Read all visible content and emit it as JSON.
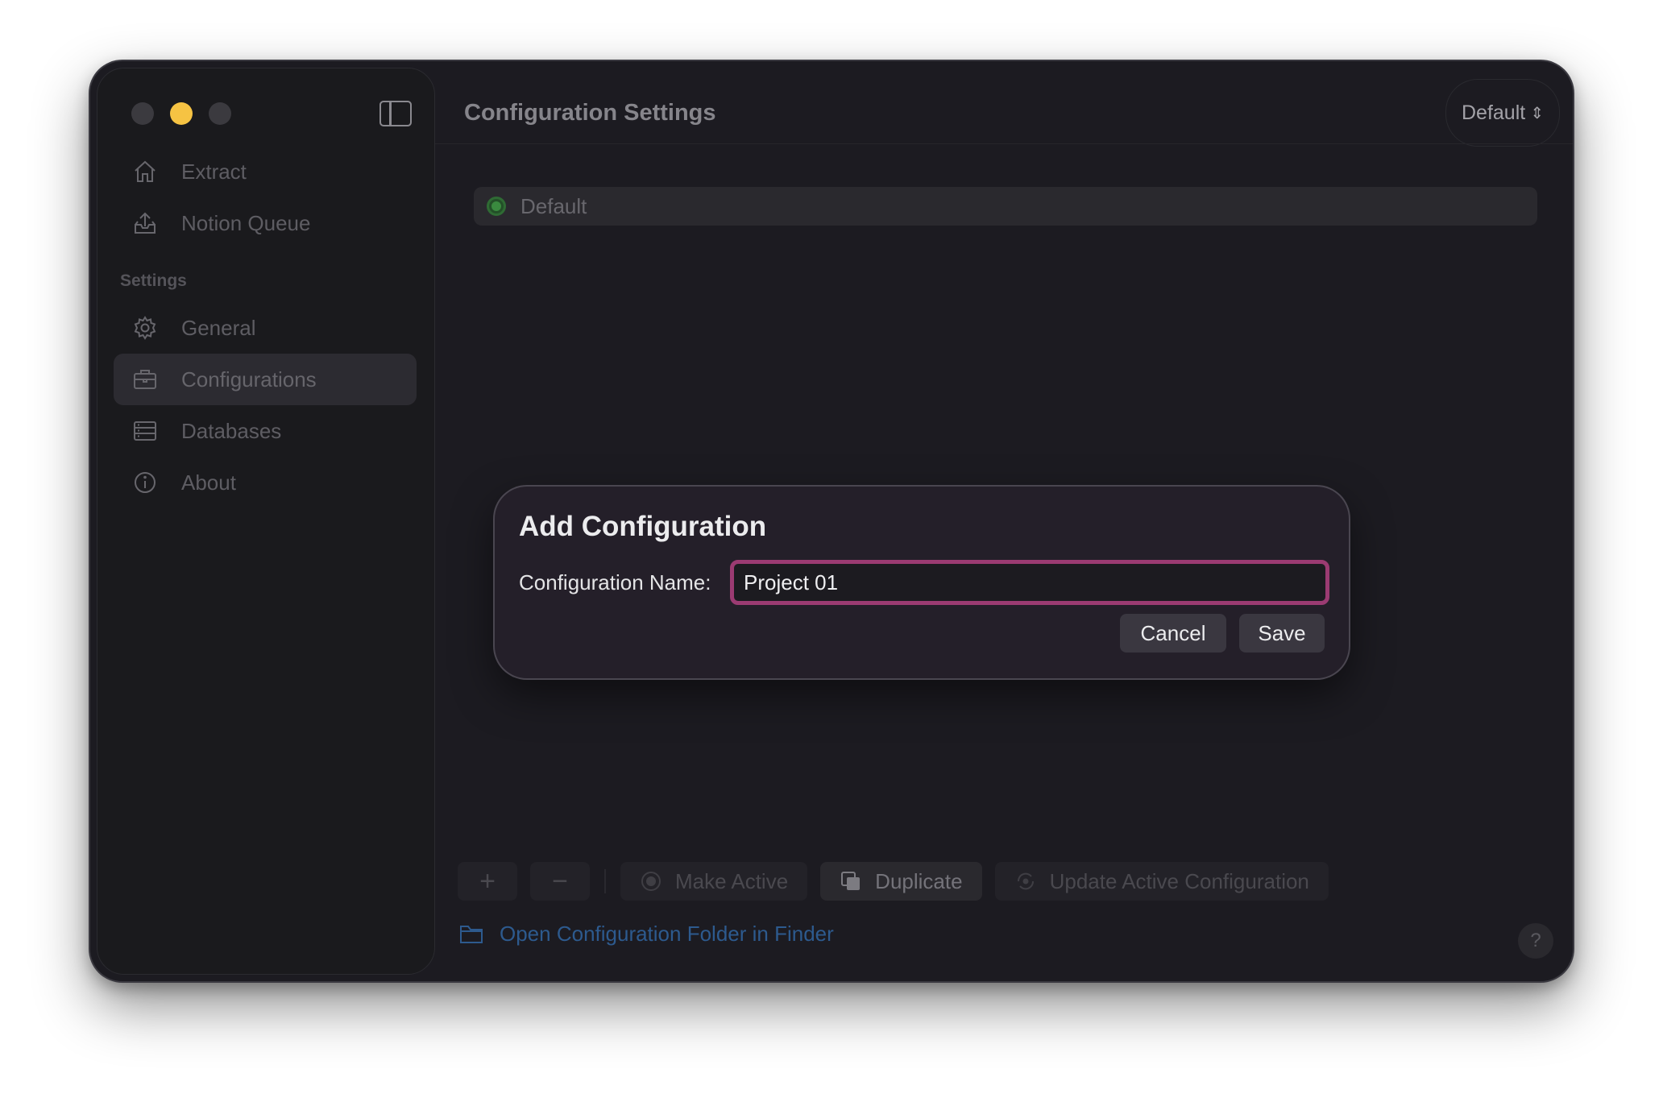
{
  "sidebar": {
    "nav_items": [
      {
        "label": "Extract",
        "icon": "house-icon"
      },
      {
        "label": "Notion Queue",
        "icon": "tray-upload-icon"
      }
    ],
    "section_label": "Settings",
    "settings_items": [
      {
        "label": "General",
        "icon": "gear-icon"
      },
      {
        "label": "Configurations",
        "icon": "briefcase-icon",
        "active": true
      },
      {
        "label": "Databases",
        "icon": "database-icon"
      },
      {
        "label": "About",
        "icon": "info-icon"
      }
    ]
  },
  "header": {
    "title": "Configuration Settings",
    "picker_value": "Default"
  },
  "config_list": [
    {
      "name": "Default",
      "active": true
    }
  ],
  "toolbar": {
    "add_label": "+",
    "remove_label": "−",
    "make_active_label": "Make Active",
    "duplicate_label": "Duplicate",
    "update_label": "Update Active Configuration"
  },
  "footer": {
    "folder_link": "Open Configuration Folder in Finder",
    "help_label": "?"
  },
  "dialog": {
    "title": "Add Configuration",
    "field_label": "Configuration Name:",
    "field_value": "Project 01",
    "cancel_label": "Cancel",
    "save_label": "Save"
  },
  "colors": {
    "accent_focus": "#9b3b72",
    "active_green": "#3a8a3f",
    "link_blue": "#2d5a8e"
  }
}
